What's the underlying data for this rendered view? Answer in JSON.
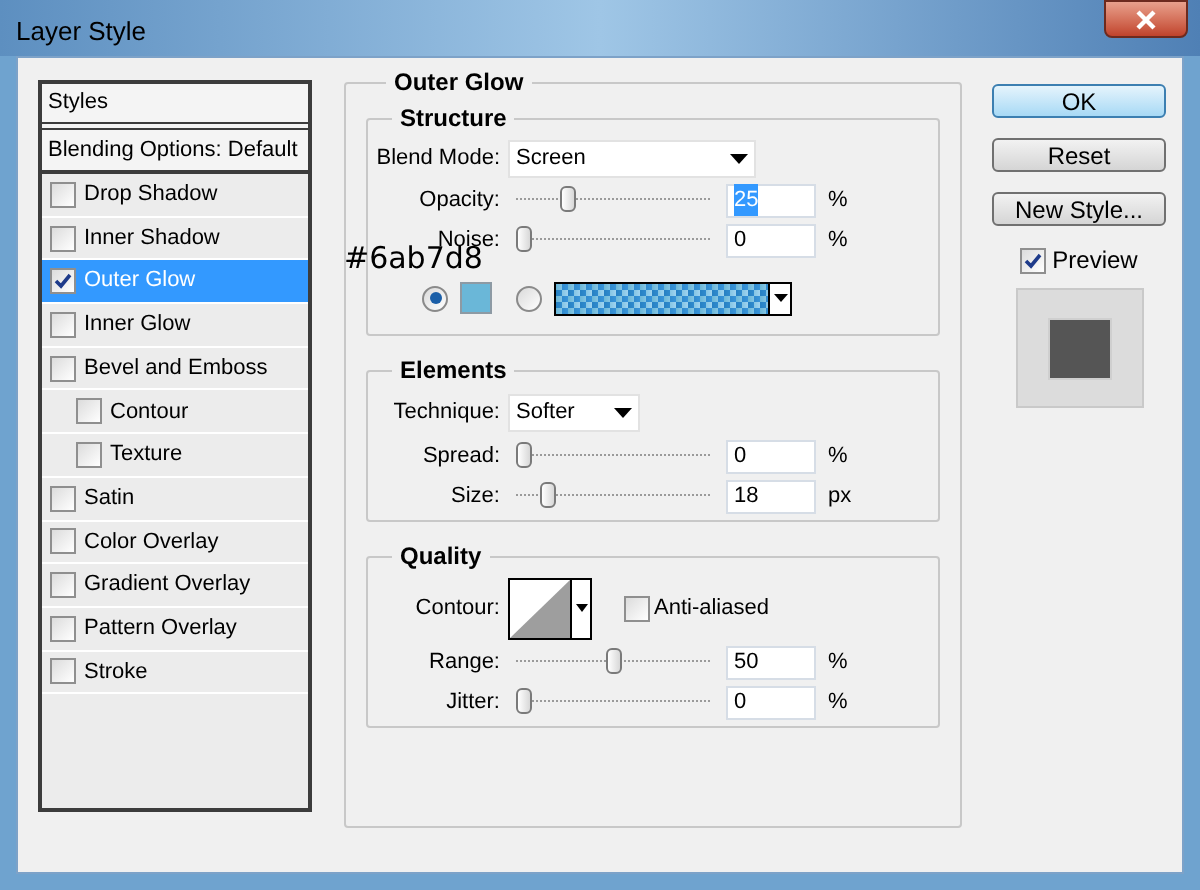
{
  "window": {
    "title": "Layer Style"
  },
  "styles_list": {
    "header": "Styles",
    "blending_options": "Blending Options: Default",
    "items": [
      {
        "label": "Drop Shadow",
        "checked": false,
        "selected": false
      },
      {
        "label": "Inner Shadow",
        "checked": false,
        "selected": false
      },
      {
        "label": "Outer Glow",
        "checked": true,
        "selected": true
      },
      {
        "label": "Inner Glow",
        "checked": false,
        "selected": false
      },
      {
        "label": "Bevel and Emboss",
        "checked": false,
        "selected": false,
        "children": [
          {
            "label": "Contour",
            "checked": false,
            "selected": false
          },
          {
            "label": "Texture",
            "checked": false,
            "selected": false
          }
        ]
      },
      {
        "label": "Satin",
        "checked": false,
        "selected": false
      },
      {
        "label": "Color Overlay",
        "checked": false,
        "selected": false
      },
      {
        "label": "Gradient Overlay",
        "checked": false,
        "selected": false
      },
      {
        "label": "Pattern Overlay",
        "checked": false,
        "selected": false
      },
      {
        "label": "Stroke",
        "checked": false,
        "selected": false
      }
    ]
  },
  "outer_glow": {
    "title": "Outer Glow",
    "structure": {
      "title": "Structure",
      "blend_mode": {
        "label": "Blend Mode:",
        "value": "Screen"
      },
      "sliders": [
        {
          "label": "Opacity:",
          "level": 0.25,
          "value": "25",
          "unit": "%",
          "value_selected": true
        },
        {
          "label": "Noise:",
          "level": 0,
          "value": "0",
          "unit": "%",
          "value_selected": false
        }
      ],
      "color_annotation": "#6ab7d8",
      "fill": [
        {
          "kind": "color",
          "selected": true,
          "color": "#6ab7d8"
        },
        {
          "kind": "gradient",
          "selected": false
        }
      ]
    },
    "elements": {
      "title": "Elements",
      "technique": {
        "label": "Technique:",
        "value": "Softer"
      },
      "sliders": [
        {
          "label": "Spread:",
          "level": 0,
          "value": "0",
          "unit": "%",
          "value_selected": false
        },
        {
          "label": "Size:",
          "level": 0.13,
          "value": "18",
          "unit": "px",
          "value_selected": false
        }
      ]
    },
    "quality": {
      "title": "Quality",
      "contour_label": "Contour:",
      "anti_aliased": {
        "label": "Anti-aliased",
        "checked": false
      },
      "sliders": [
        {
          "label": "Range:",
          "level": 0.5,
          "value": "50",
          "unit": "%",
          "value_selected": false
        },
        {
          "label": "Jitter:",
          "level": 0,
          "value": "0",
          "unit": "%",
          "value_selected": false
        }
      ]
    }
  },
  "buttons": [
    {
      "label": "OK",
      "default": true
    },
    {
      "label": "Reset",
      "default": false
    },
    {
      "label": "New Style...",
      "default": false
    }
  ],
  "preview": {
    "label": "Preview",
    "checked": true
  }
}
